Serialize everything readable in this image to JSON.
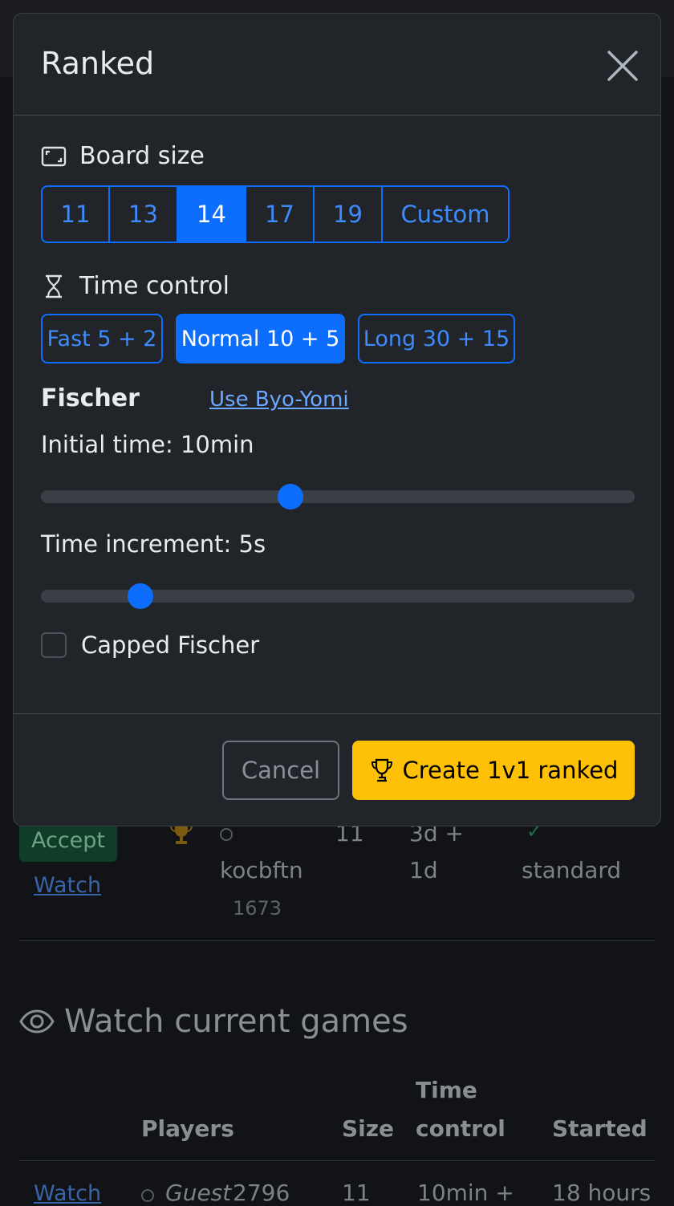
{
  "background": {
    "game_row": {
      "accept_label": "Accept",
      "watch_label": "Watch",
      "player": "kocbftn",
      "rating": "1673",
      "size": "11",
      "time_line1": "3d +",
      "time_line2": "1d",
      "check": "✓",
      "type": "standard"
    },
    "watch_section": {
      "title": "Watch current games",
      "headers": {
        "players": "Players",
        "size": "Size",
        "time_control_1": "Time",
        "time_control_2": "control",
        "started": "Started"
      },
      "row": {
        "watch": "Watch",
        "player": "Guest",
        "rating": "2796",
        "size": "11",
        "time": "10min +",
        "started": "18 hours"
      }
    }
  },
  "modal": {
    "title": "Ranked",
    "board_size": {
      "label": "Board size",
      "options": [
        "11",
        "13",
        "14",
        "17",
        "19",
        "Custom"
      ],
      "selected": "14"
    },
    "time_control": {
      "label": "Time control",
      "options": [
        "Fast 5 + 2",
        "Normal 10 + 5",
        "Long 30 + 15"
      ],
      "selected": "Normal 10 + 5"
    },
    "fischer": {
      "label": "Fischer",
      "byoyomi_link": "Use Byo-Yomi",
      "initial_time_label": "Initial time: 10min",
      "initial_time_fraction": 0.42,
      "increment_label": "Time increment: 5s",
      "increment_fraction": 0.167,
      "capped_label": "Capped Fischer",
      "capped_checked": false
    },
    "buttons": {
      "cancel": "Cancel",
      "create": "Create 1v1 ranked"
    }
  },
  "colors": {
    "primary": "#0d6efd",
    "warning": "#ffc107",
    "modal_bg": "#212529",
    "page_bg": "#121316"
  }
}
